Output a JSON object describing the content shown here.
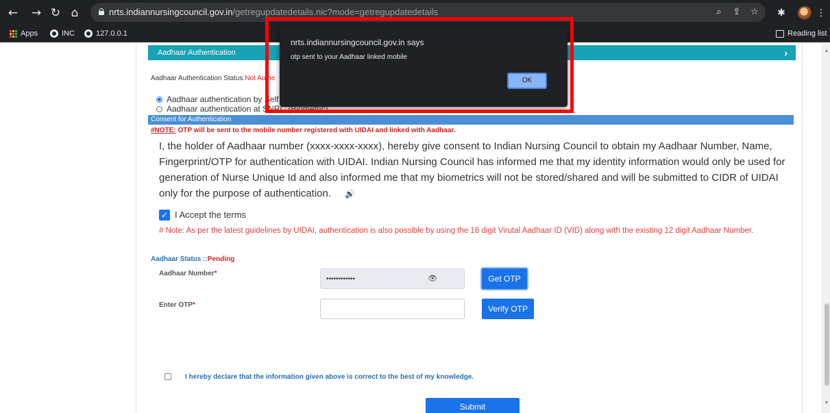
{
  "browser": {
    "url_host": "nrts.indiannursingcouncil.gov.in",
    "url_path": "/getregupdatedetails.nic?mode=getregupdatedetails",
    "bookmarks": [
      "Apps",
      "INC",
      "127.0.0.1"
    ],
    "reading_list": "Reading list"
  },
  "section": {
    "header": "Aadhaar Authentication",
    "auth_status_label": "Aadhaar Authentication Status:",
    "auth_status_value": "Not Authe",
    "radio_self": "Aadhaar authentication by Self (Through OTP)",
    "radio_center": "Aadhaar authentication at SNRC (Biometric)"
  },
  "consent": {
    "bar_title": "Consent for Authentication",
    "note_prefix": "#NOTE:",
    "note_text": " OTP will be sent to the mobile number registered with UIDAI and linked with Aadhaar.",
    "body": "I, the holder of Aadhaar number (xxxx-xxxx-xxxx), hereby give consent to Indian Nursing Council to obtain my Aadhaar Number, Name, Fingerprint/OTP for authentication with UIDAI. Indian Nursing Council has informed me that my identity information would only be used for generation of Nurse Unique Id and also informed me that my biometrics will not be stored/shared and will be submitted to CIDR of UIDAI only for the purpose of authentication.",
    "accept_label": "I Accept the terms",
    "vid_note": "# Note: As per the latest guidelines by UIDAI, authentication is also possible by using the 16 digit Virutal Aadhaar ID (VID) along with the existing 12 digit Aadhaar Number."
  },
  "form": {
    "status_label": "Aadhaar Status ::",
    "status_value": "Pending",
    "aadhaar_label": "Aadhaar Number",
    "aadhaar_masked": "••••••••••••",
    "get_otp": "Get OTP",
    "otp_label": "Enter OTP",
    "verify_otp": "Verify OTP",
    "required_mark": "*",
    "declaration": "I hereby declare that the information given above is correct to the best of my knowledge.",
    "submit": "Submit"
  },
  "dialog": {
    "title": "nrts.indiannursingcouncil.gov.in says",
    "message": "otp sent to your Aadhaar linked mobile",
    "ok": "OK"
  },
  "colors": {
    "header_teal": "#17a2b8",
    "consent_blue": "#4a8fd4",
    "button_blue": "#1a73e8",
    "annotation_red": "#ff0000"
  }
}
